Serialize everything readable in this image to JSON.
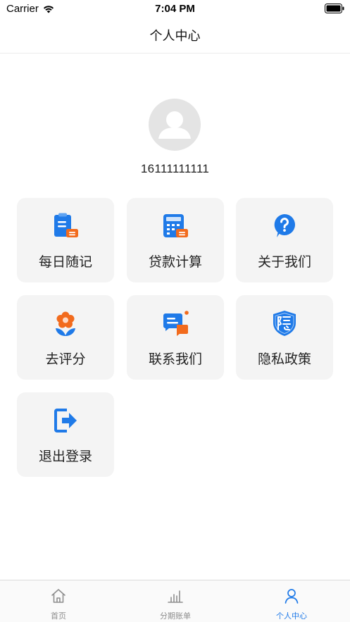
{
  "status_bar": {
    "carrier": "Carrier",
    "time": "7:04 PM"
  },
  "nav": {
    "title": "个人中心"
  },
  "profile": {
    "phone": "16111111111"
  },
  "menu": [
    {
      "label": "每日随记",
      "icon": "notepad-icon"
    },
    {
      "label": "贷款计算",
      "icon": "calculator-icon"
    },
    {
      "label": "关于我们",
      "icon": "question-icon"
    },
    {
      "label": "去评分",
      "icon": "flower-icon"
    },
    {
      "label": "联系我们",
      "icon": "chat-icon"
    },
    {
      "label": "隐私政策",
      "icon": "privacy-shield-icon"
    },
    {
      "label": "退出登录",
      "icon": "logout-icon"
    }
  ],
  "tabs": [
    {
      "label": "首页",
      "icon": "home-icon",
      "active": false
    },
    {
      "label": "分期账单",
      "icon": "bar-chart-icon",
      "active": false
    },
    {
      "label": "个人中心",
      "icon": "user-icon",
      "active": true
    }
  ],
  "colors": {
    "accent": "#1f7ae8",
    "orange": "#f26b1d",
    "card_bg": "#f4f4f4"
  }
}
